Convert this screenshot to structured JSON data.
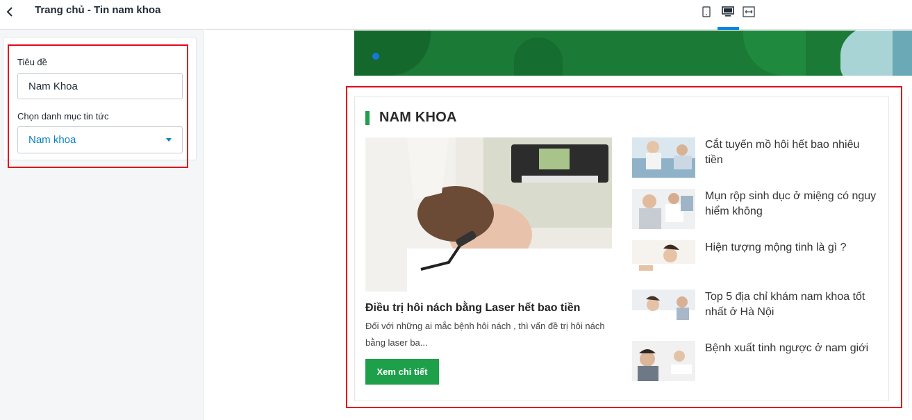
{
  "panel": {
    "title": "Trang chủ - Tin nam khoa",
    "title_field_label": "Tiêu đề",
    "title_field_value": "Nam Khoa",
    "category_label": "Chọn danh mục tin tức",
    "category_value": "Nam khoa"
  },
  "toolbar": {
    "devices": [
      "mobile-icon",
      "desktop-icon",
      "fullwidth-icon"
    ],
    "active_device": "desktop"
  },
  "section": {
    "title": "NAM KHOA",
    "feature": {
      "title": "Điều trị hôi nách bằng Laser hết bao tiền",
      "description": "Đối với những ai mắc bệnh hôi nách , thì vấn đề trị hôi nách bằng laser ba...",
      "button_label": "Xem chi tiết"
    },
    "news": [
      {
        "title": "Cắt tuyến mồ hôi hết bao nhiêu tiền"
      },
      {
        "title": "Mụn rộp sinh dục ở miệng có nguy hiểm không"
      },
      {
        "title": "Hiện tượng mộng tinh là gì ?"
      },
      {
        "title": "Top 5 địa chỉ khám nam khoa tốt nhất ở Hà Nội"
      },
      {
        "title": "Bệnh xuất tinh ngược ở nam giới"
      }
    ]
  },
  "colors": {
    "accent_green": "#1ea04b",
    "highlight_red": "#e0081a",
    "link_blue": "#0a7fc0"
  }
}
